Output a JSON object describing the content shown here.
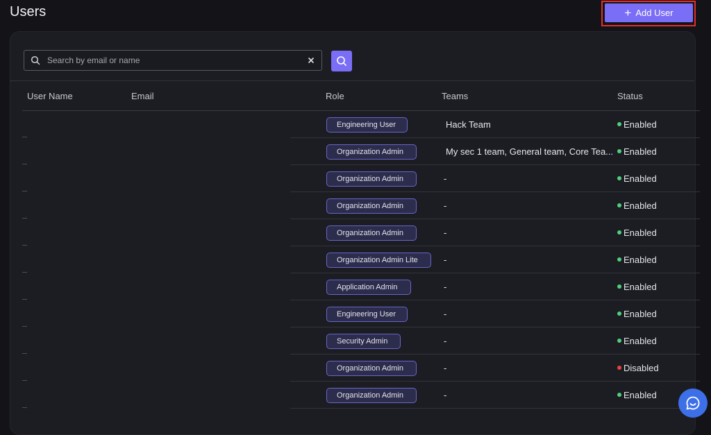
{
  "page": {
    "title": "Users"
  },
  "toolbar": {
    "add_user_label": "Add User",
    "add_user_icon": "plus-icon"
  },
  "search": {
    "placeholder": "Search by email or name",
    "value": ""
  },
  "table": {
    "columns": [
      "User Name",
      "Email",
      "Role",
      "Teams",
      "Status"
    ],
    "rows": [
      {
        "role": "Engineering User",
        "teams": "Hack Team",
        "status": "Enabled"
      },
      {
        "role": "Organization Admin",
        "teams": "My sec 1 team, General team, Core Tea...",
        "status": "Enabled"
      },
      {
        "role": "Organization Admin",
        "teams": "-",
        "status": "Enabled"
      },
      {
        "role": "Organization Admin",
        "teams": "-",
        "status": "Enabled"
      },
      {
        "role": "Organization Admin",
        "teams": "-",
        "status": "Enabled"
      },
      {
        "role": "Organization Admin Lite",
        "teams": "-",
        "status": "Enabled"
      },
      {
        "role": "Application Admin",
        "teams": "-",
        "status": "Enabled"
      },
      {
        "role": "Engineering User",
        "teams": "-",
        "status": "Enabled"
      },
      {
        "role": "Security Admin",
        "teams": "-",
        "status": "Enabled"
      },
      {
        "role": "Organization Admin",
        "teams": "-",
        "status": "Disabled"
      },
      {
        "role": "Organization Admin",
        "teams": "-",
        "status": "Enabled"
      }
    ]
  },
  "colors": {
    "accent": "#7b6ef6",
    "enabled": "#4fd07a",
    "disabled": "#e8433d",
    "highlight": "#e0302a",
    "chat": "#3d6fe8"
  }
}
